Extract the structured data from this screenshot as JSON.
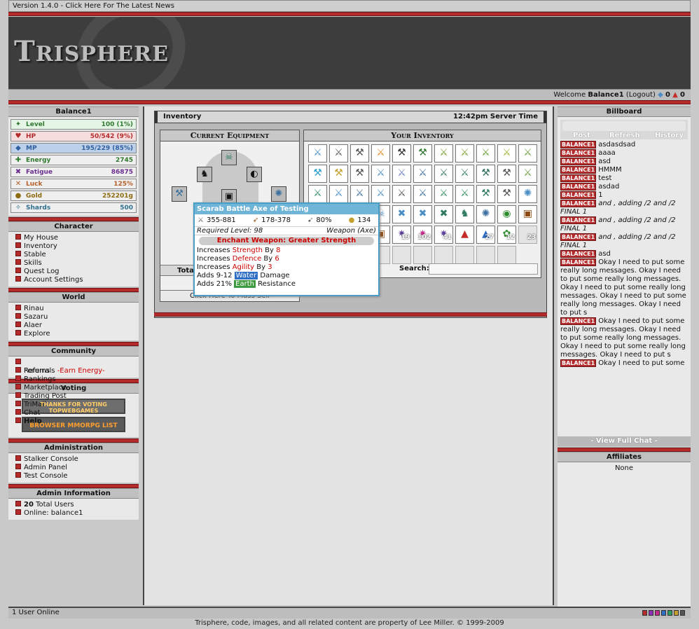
{
  "topbar": {
    "news": "Version 1.4.0 - Click Here For The Latest News"
  },
  "banner": {
    "logo_a": "T",
    "logo_b": "RISPHERE"
  },
  "welcome": {
    "prefix": "Welcome ",
    "user": "Balance1",
    "logout": "(Logout)",
    "gems": "0",
    "potions": "0"
  },
  "left": {
    "player_header": "Balance1",
    "stats": [
      {
        "label": "Level",
        "value": "100 (1%)",
        "color": "#2f7a2f",
        "bg": "#e5f5e5",
        "icon": "level-icon",
        "glyph": "✦"
      },
      {
        "label": "HP",
        "value": "50/542 (9%)",
        "color": "#b52a2a",
        "bg": "#f7dede",
        "icon": "heart-icon",
        "glyph": "♥"
      },
      {
        "label": "MP",
        "value": "195/229 (85%)",
        "color": "#2f5f9e",
        "bg": "#bcd0ea",
        "icon": "mana-icon",
        "glyph": "◆"
      },
      {
        "label": "Energy",
        "value": "2745",
        "color": "#2f7a2f",
        "bg": "#efefef",
        "icon": "energy-icon",
        "glyph": "✚"
      },
      {
        "label": "Fatigue",
        "value": "86875",
        "color": "#6a2f8e",
        "bg": "#efefef",
        "icon": "fatigue-icon",
        "glyph": "✖"
      },
      {
        "label": "Luck",
        "value": "125%",
        "color": "#b5602a",
        "bg": "#efefef",
        "icon": "luck-icon",
        "glyph": "✕"
      },
      {
        "label": "Gold",
        "value": "252201g",
        "color": "#8e6a10",
        "bg": "#efefef",
        "icon": "gold-icon",
        "glyph": "●"
      },
      {
        "label": "Shards",
        "value": "500",
        "color": "#2f6f8e",
        "bg": "#efefef",
        "icon": "shard-icon",
        "glyph": "✧"
      }
    ],
    "character_header": "Character",
    "character": [
      "My House",
      "Inventory",
      "Stable",
      "Skills",
      "Quest Log",
      "Account Settings"
    ],
    "world_header": "World",
    "world": [
      "Rinau",
      "Sazaru",
      "Alaer",
      "Explore"
    ],
    "community_header": "Community",
    "community": [
      "Forums",
      "Rankings",
      "Marketplace",
      "Trading Post",
      "TriMail",
      "Chat",
      "Help"
    ],
    "referrals": "Referrals",
    "earn": "-Earn Energy-",
    "voting_header": "Voting",
    "vote1_a": "THANKS FOR VOTING",
    "vote1_b": "TOPWEBGAMES",
    "vote2": "BROWSER MMORPG LIST",
    "admin_header": "Administration",
    "admin": [
      "Stalker Console",
      "Admin Panel",
      "Test Console"
    ],
    "admin_info_header": "Admin Information",
    "total_users_count": "20",
    "total_users_label": " Total Users",
    "online": "Online: balance1"
  },
  "inventory": {
    "title": "Inventory",
    "server_time": "12:42pm Server Time",
    "equipment_header": "Current Equipment",
    "inventory_header": "Your Inventory",
    "total_label": "Tota",
    "mass_sell": "Click Here To Mass Sell",
    "search_label": "Search:",
    "items": [
      {
        "g": "⚔",
        "c": "#4a8ec5"
      },
      {
        "g": "⚔",
        "c": "#555"
      },
      {
        "g": "⚒",
        "c": "#555"
      },
      {
        "g": "⚔",
        "c": "#e08a20"
      },
      {
        "g": "⚒",
        "c": "#333"
      },
      {
        "g": "⚒",
        "c": "#2f7a2f"
      },
      {
        "g": "⚔",
        "c": "#7a9e2f"
      },
      {
        "g": "⚔",
        "c": "#7a9e2f"
      },
      {
        "g": "⚔",
        "c": "#5f9e2f"
      },
      {
        "g": "⚔",
        "c": "#9eb52f"
      },
      {
        "g": "⚔",
        "c": "#6a9e3f"
      },
      {
        "g": "⚒",
        "c": "#2fa0d0"
      },
      {
        "g": "⚒",
        "c": "#c5a02f"
      },
      {
        "g": "⚒",
        "c": "#555"
      },
      {
        "g": "⚔",
        "c": "#4a8ec5"
      },
      {
        "g": "⚔",
        "c": "#6a7ec5"
      },
      {
        "g": "⚔",
        "c": "#3a6f9e"
      },
      {
        "g": "⚔",
        "c": "#2f7a5f"
      },
      {
        "g": "⚔",
        "c": "#2f7a5f"
      },
      {
        "g": "⚒",
        "c": "#2f6f5f"
      },
      {
        "g": "⚒",
        "c": "#555"
      },
      {
        "g": "⚔",
        "c": "#6a9e3f"
      },
      {
        "g": "⚔",
        "c": "#2f8e5f"
      },
      {
        "g": "⚔",
        "c": "#4a8ec5"
      },
      {
        "g": "⚔",
        "c": "#3a6f9e"
      },
      {
        "g": "⚔",
        "c": "#4a8ec5"
      },
      {
        "g": "⚔",
        "c": "#555"
      },
      {
        "g": "⚔",
        "c": "#3a6f9e"
      },
      {
        "g": "⚔",
        "c": "#2f8e5f"
      },
      {
        "g": "⚔",
        "c": "#2f8e5f"
      },
      {
        "g": "⚒",
        "c": "#2f7a5f"
      },
      {
        "g": "⚒",
        "c": "#555"
      },
      {
        "g": "✺",
        "c": "#4a8ec5"
      },
      {
        "g": "",
        "c": "#fff"
      },
      {
        "g": "",
        "c": "#fff"
      },
      {
        "g": "⚔",
        "c": "#c5a02f"
      },
      {
        "g": "☠",
        "c": "#4a8ec5"
      },
      {
        "g": "✖",
        "c": "#4a8ec5"
      },
      {
        "g": "✖",
        "c": "#4a8ec5"
      },
      {
        "g": "✖",
        "c": "#2f7a5f"
      },
      {
        "g": "♞",
        "c": "#2f7a5f"
      },
      {
        "g": "✺",
        "c": "#3a6f9e"
      },
      {
        "g": "◉",
        "c": "#2f8e2f"
      },
      {
        "g": "▣",
        "c": "#8e4a10"
      },
      {
        "g": "",
        "c": "#fff"
      },
      {
        "g": "",
        "c": "#fff"
      },
      {
        "g": "▣",
        "c": "#8e4a10"
      },
      {
        "g": "▣",
        "c": "#8e4a10"
      },
      {
        "g": "✷",
        "c": "#5f3f9e",
        "q": "19"
      },
      {
        "g": "✷",
        "c": "#c52a8e",
        "q": "102"
      },
      {
        "g": "✷",
        "c": "#5f3f9e",
        "q": "41"
      },
      {
        "g": "▲",
        "c": "#c52a2a"
      },
      {
        "g": "▲",
        "c": "#2f6fc6",
        "q": "27"
      },
      {
        "g": "✿",
        "c": "#2f8e2f",
        "q": "12"
      },
      {
        "g": "",
        "c": "#fff",
        "q": "23",
        "e": true
      },
      {
        "g": "",
        "c": "#fff",
        "e": true
      },
      {
        "g": "",
        "c": "#fff",
        "e": true
      },
      {
        "g": "",
        "c": "#fff",
        "e": true
      },
      {
        "g": "",
        "c": "#fff",
        "e": true
      },
      {
        "g": "",
        "c": "#fff",
        "e": true
      },
      {
        "g": "",
        "c": "#fff",
        "e": true
      },
      {
        "g": "",
        "c": "#fff",
        "e": true
      },
      {
        "g": "",
        "c": "#fff",
        "e": true
      },
      {
        "g": "",
        "c": "#fff",
        "e": true
      },
      {
        "g": "",
        "c": "#fff",
        "e": true
      }
    ]
  },
  "tooltip": {
    "title": "Scarab Battle Axe of Testing",
    "damage": "355-881",
    "range": "178-378",
    "accuracy": "80%",
    "gold": "134",
    "required_level": "Required Level: 98",
    "type": "Weapon (Axe)",
    "enchant": "Enchant Weapon: Greater Strength",
    "l1a": "Increases ",
    "l1b": "Strength",
    "l1c": " By ",
    "l1d": "8",
    "l2a": "Increases ",
    "l2b": "Defence",
    "l2c": " By ",
    "l2d": "6",
    "l3a": "Increases ",
    "l3b": "Agility",
    "l3c": " By ",
    "l3d": "3",
    "l4a": "Adds 9-12 ",
    "l4b": "Water",
    "l4c": " Damage",
    "l5a": "Adds 21% ",
    "l5b": "Earth",
    "l5c": " Resistance"
  },
  "billboard": {
    "header": "Billboard",
    "post": "Post",
    "refresh": "Refresh",
    "history": "History",
    "user_tag": "BALANCE1",
    "messages": [
      {
        "text": "asdasdsad"
      },
      {
        "text": "aaaa"
      },
      {
        "text": "asd"
      },
      {
        "text": "HMMM"
      },
      {
        "text": "test"
      },
      {
        "text": "asdad"
      },
      {
        "text": "1"
      },
      {
        "text": "and , adding /2 and /2 FINAL 1",
        "i": true
      },
      {
        "text": "and , adding /2 and /2 FINAL 1",
        "i": true
      },
      {
        "text": "and , adding /2 and /2 FINAL 1",
        "i": true
      },
      {
        "text": "asd"
      },
      {
        "text": "Okay I need to put some really long messages. Okay I need to put some really long messages. Okay I need to put some really long messages. Okay I need to put some really long messages. Okay I need to put s"
      },
      {
        "text": "Okay I need to put some really long messages. Okay I need to put some really long messages. Okay I need to put some really long messages. Okay I need to put s"
      },
      {
        "text": "Okay I need to put some"
      }
    ],
    "view_full": "- View Full Chat -",
    "affiliates_header": "Affiliates",
    "affiliates": "None"
  },
  "footer": {
    "online": "1 User Online",
    "copyright": "Trisphere, code, images, and all related content are property of Lee Miller. © 1999-2009",
    "swatches": [
      "#b52a2a",
      "#8e2fb5",
      "#c52a8e",
      "#2f6fc6",
      "#2f9e5f",
      "#c5a02f",
      "#555555"
    ]
  }
}
